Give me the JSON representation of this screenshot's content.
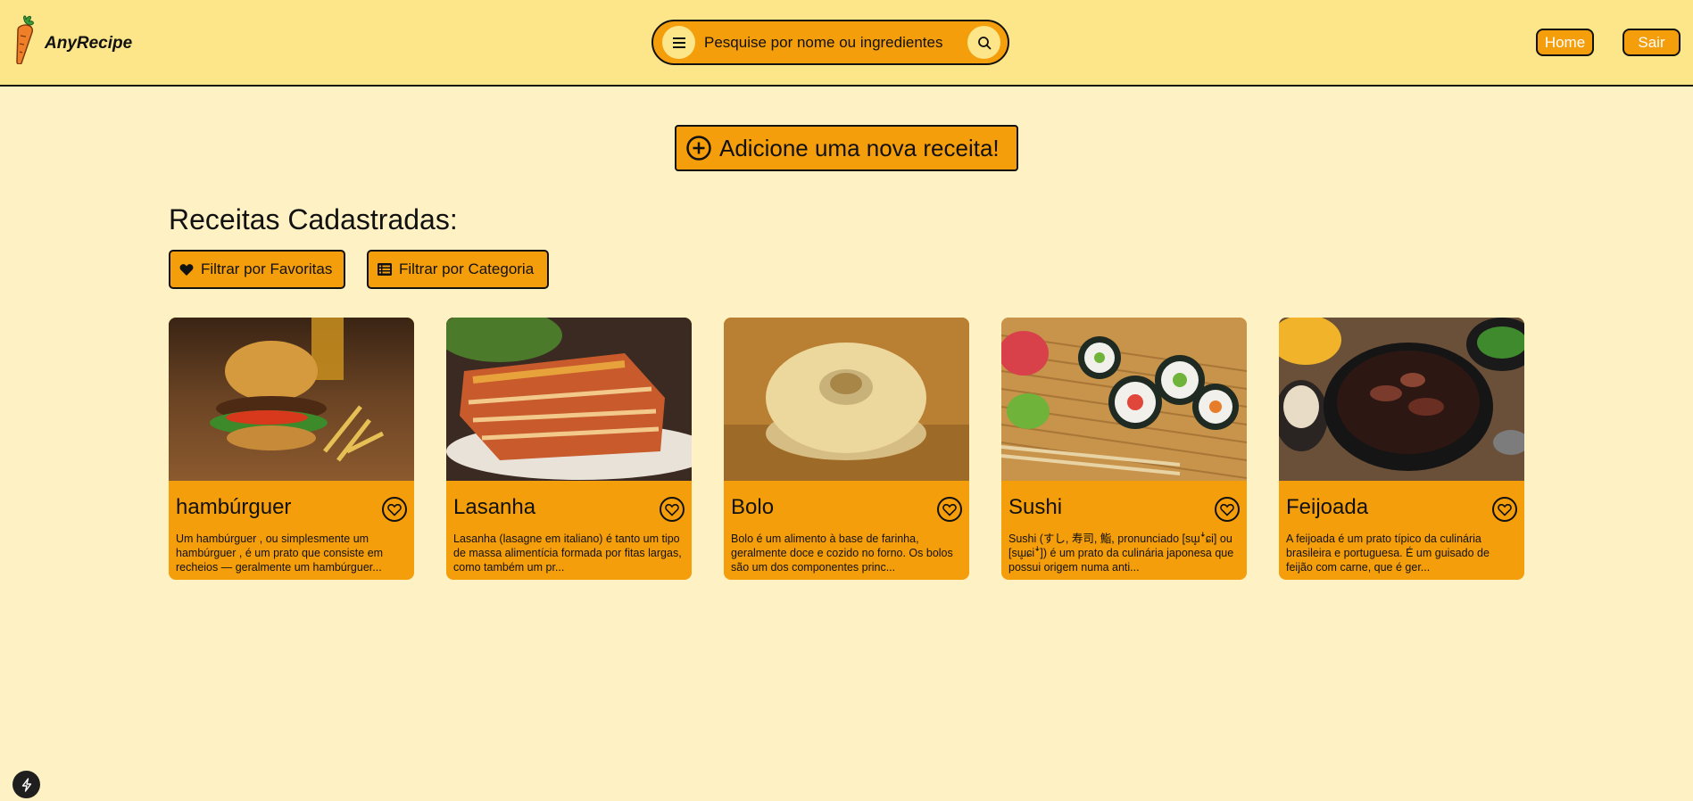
{
  "app": {
    "name": "AnyRecipe"
  },
  "header": {
    "search_placeholder": "Pesquise por nome ou ingredientes",
    "nav": {
      "home_label": "Home",
      "exit_label": "Sair"
    }
  },
  "main": {
    "add_recipe_label": "Adicione uma nova receita!",
    "section_title": "Receitas Cadastradas:",
    "filters": {
      "favorites_label": "Filtrar por Favoritas",
      "category_label": "Filtrar por Categoria"
    },
    "recipes": [
      {
        "title": "hambúrguer",
        "description": "Um hambúrguer , ou simplesmente um hambúrguer , é um prato que consiste em recheios — geralmente um hambúrguer..."
      },
      {
        "title": "Lasanha",
        "description": "Lasanha (lasagne em italiano) é tanto um tipo de massa alimentícia formada por fitas largas, como também um pr..."
      },
      {
        "title": "Bolo",
        "description": "Bolo é um alimento à base de farinha, geralmente doce e cozido no forno. Os bolos são um dos componentes princ..."
      },
      {
        "title": "Sushi",
        "description": "Sushi (すし, 寿司, 鮨, pronunciado [sɯ̥ꜜɕi] ou [sɯ̥ɕiꜜ]) é um prato da culinária japonesa que possui origem numa anti..."
      },
      {
        "title": "Feijoada",
        "description": "A feijoada é um prato típico da culinária brasileira e portuguesa. É um guisado de feijão com carne, que é ger..."
      }
    ]
  },
  "colors": {
    "page_background": "#fef2c4",
    "header_background": "#fde68a",
    "accent": "#f59e0b",
    "text": "#111111"
  },
  "icons": {
    "logo": "carrot-icon",
    "menu": "menu-icon",
    "search": "search-icon",
    "add": "plus-circle-icon",
    "favorites_filter": "heart-icon",
    "category_filter": "list-icon",
    "card_favorite": "heart-outline-icon",
    "floating_badge": "bolt-icon"
  }
}
